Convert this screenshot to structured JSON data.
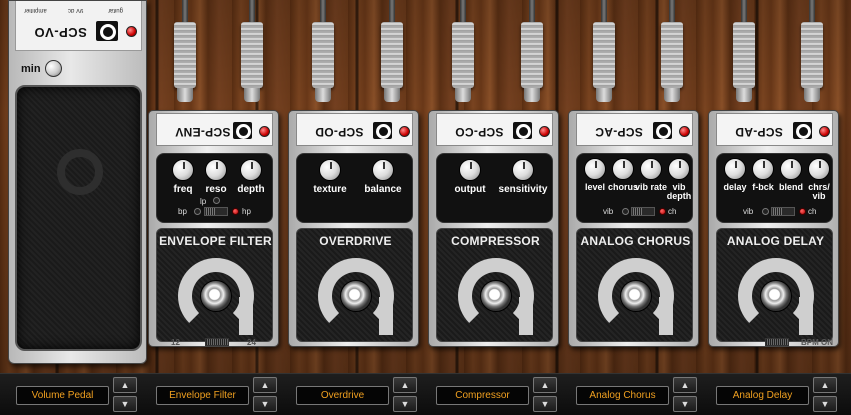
{
  "volume_pedal": {
    "name": "SCP-VO",
    "knob_label": "min",
    "jack_labels": [
      "amplifier",
      "9V dc",
      "guitar"
    ]
  },
  "pedals": [
    {
      "id": "envelope-filter",
      "name": "SCP-ENV",
      "title": "ENVELOPE FILTER",
      "knobs": [
        "freq",
        "reso",
        "depth"
      ],
      "switch": {
        "left": "bp",
        "middle": "lp",
        "right": "hp"
      },
      "footer": {
        "left": "12",
        "right": "24"
      }
    },
    {
      "id": "overdrive",
      "name": "SCP-OD",
      "title": "OVERDRIVE",
      "knobs": [
        "texture",
        "balance"
      ]
    },
    {
      "id": "compressor",
      "name": "SCP-CO",
      "title": "COMPRESSOR",
      "knobs": [
        "output",
        "sensitivity"
      ]
    },
    {
      "id": "analog-chorus",
      "name": "SCP-AC",
      "title": "ANALOG CHORUS",
      "knobs": [
        "level",
        "chorus",
        "vib rate",
        "vib depth"
      ],
      "switch": {
        "left": "vib",
        "right": "ch"
      }
    },
    {
      "id": "analog-delay",
      "name": "SCP-AD",
      "title": "ANALOG DELAY",
      "knobs": [
        "delay",
        "f-bck",
        "blend",
        "chrs/ vib"
      ],
      "switch": {
        "left": "vib",
        "right": "ch"
      },
      "footer": {
        "right": "BPM ON"
      }
    }
  ],
  "slots": [
    "Volume Pedal",
    "Envelope Filter",
    "Overdrive",
    "Compressor",
    "Analog Chorus",
    "Analog Delay"
  ],
  "arrow_up": "▲",
  "arrow_down": "▼",
  "colors": {
    "slot_text": "#f0a020",
    "led_red": "#cc0000"
  }
}
